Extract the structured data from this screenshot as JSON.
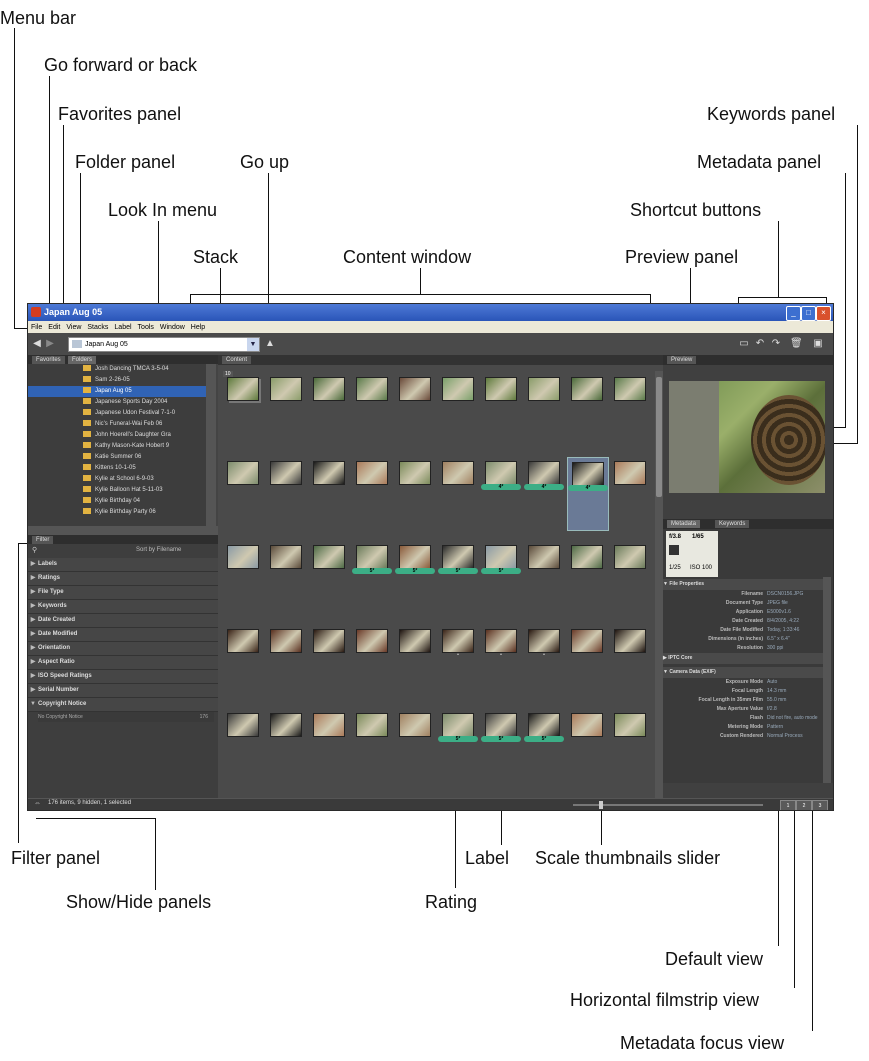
{
  "callouts": {
    "menu_bar": "Menu bar",
    "go_forward_back": "Go forward or back",
    "favorites_panel": "Favorites panel",
    "folder_panel": "Folder panel",
    "go_up": "Go up",
    "look_in_menu": "Look In menu",
    "stack": "Stack",
    "content_window": "Content window",
    "keywords_panel": "Keywords panel",
    "metadata_panel": "Metadata panel",
    "shortcut_buttons": "Shortcut buttons",
    "preview_panel": "Preview panel",
    "filter_panel": "Filter panel",
    "show_hide_panels": "Show/Hide panels",
    "label": "Label",
    "scale_slider": "Scale thumbnails slider",
    "rating": "Rating",
    "default_view": "Default view",
    "horizontal_filmstrip": "Horizontal filmstrip view",
    "metadata_focus": "Metadata focus view"
  },
  "window": {
    "title": "Japan Aug 05",
    "menu": [
      "File",
      "Edit",
      "View",
      "Stacks",
      "Label",
      "Tools",
      "Window",
      "Help"
    ],
    "look_in": "Japan Aug 05"
  },
  "folders": [
    "Josh Dancing TMCA 3-5-04",
    "Sam 2-26-05",
    "Japan Aug 05",
    "Japanese Sports Day 2004",
    "Japanese Udon Festival 7-1-0",
    "Nic's Funeral-Wai Feb 06",
    "John Hoerell's Daughter Gra",
    "Kathy Mason-Kate Hobert 9",
    "Katie Summer 06",
    "Kittens 10-1-05",
    "Kylie at School 6-9-03",
    "Kylie Balloon Hat 5-11-03",
    "Kylie Birthday 04",
    "Kylie Birthday Party 06"
  ],
  "selected_folder_index": 2,
  "filter": {
    "sort_label": "Sort by Filename",
    "sections": [
      "Labels",
      "Ratings",
      "File Type",
      "Keywords",
      "Date Created",
      "Date Modified",
      "Orientation",
      "Aspect Ratio",
      "ISO Speed Ratings",
      "Serial Number",
      "Copyright Notice"
    ],
    "copyright_row": "No Copyright Notice",
    "copyright_count": "176"
  },
  "status": "176 items, 9 hidden, 1 selected",
  "metadata": {
    "quick": [
      "f/3.8",
      "1/65",
      "-",
      "1/25",
      "ISO 100"
    ],
    "file_props_title": "File Properties",
    "file_props": [
      [
        "Filename",
        "DSCN0156.JPG"
      ],
      [
        "Document Type",
        "JPEG file"
      ],
      [
        "Application",
        "E5000v1.6"
      ],
      [
        "Date Created",
        "8/4/2005, 4:22"
      ],
      [
        "Date File Modified",
        "Today, 1:33:46"
      ],
      [
        "Dimensions (in inches)",
        "6.5\" x 6.4\""
      ],
      [
        "Resolution",
        "300 ppi"
      ]
    ],
    "iptc": "IPTC Core",
    "camera_title": "Camera Data (EXIF)",
    "camera": [
      [
        "Exposure Mode",
        "Auto"
      ],
      [
        "Focal Length",
        "14.3 mm"
      ],
      [
        "Focal Length in 35mm Film",
        "55.0 mm"
      ],
      [
        "Max Aperture Value",
        "f/2.8"
      ],
      [
        "Flash",
        "Did not fire, auto mode"
      ],
      [
        "Metering Mode",
        "Pattern"
      ],
      [
        "Custom Rendered",
        "Normal Process"
      ]
    ]
  },
  "ratings": {
    "row2": [
      "4*",
      "4*",
      "4*"
    ],
    "row3": [
      "5*",
      "5*",
      "5*",
      "5*"
    ],
    "row5": [
      "5*",
      "5*",
      "5*"
    ]
  }
}
